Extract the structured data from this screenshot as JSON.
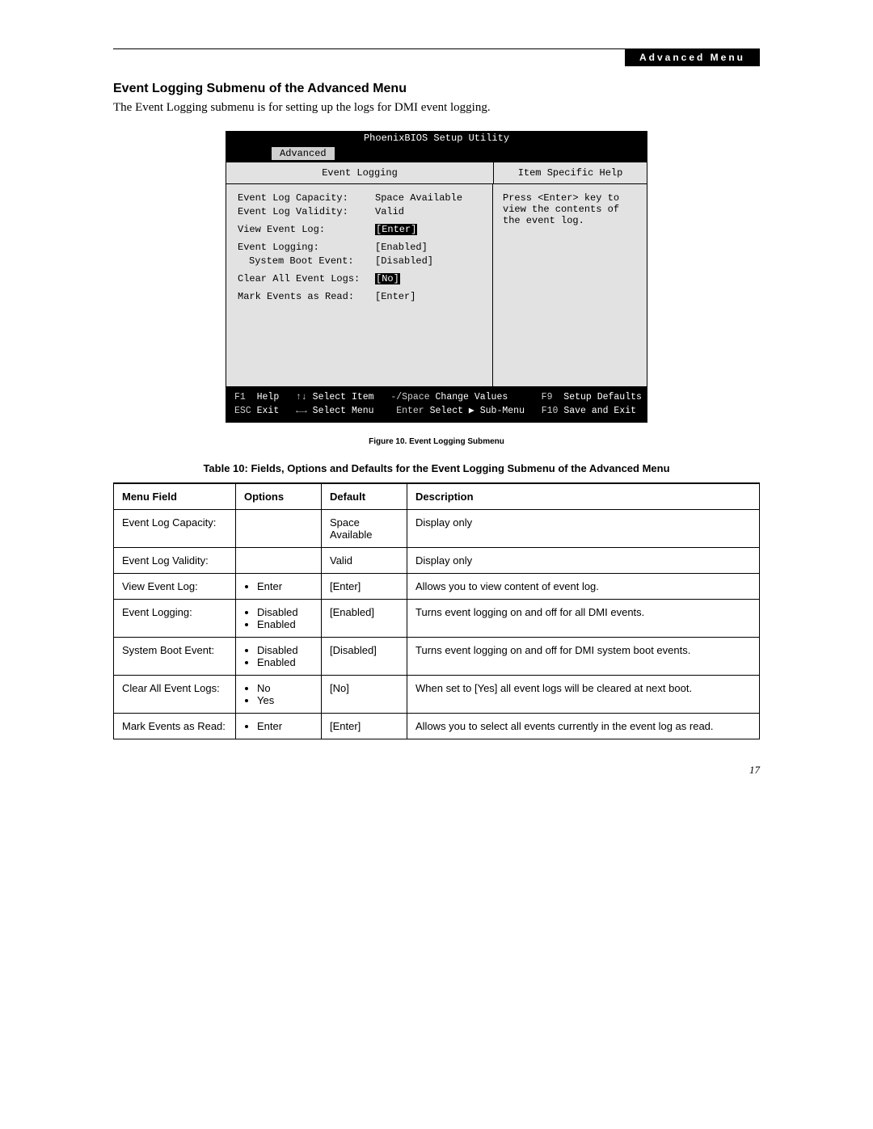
{
  "header": {
    "tab": "Advanced Menu"
  },
  "section": {
    "title": "Event Logging Submenu of the Advanced Menu",
    "intro": "The Event Logging submenu is for setting up the logs for DMI event logging."
  },
  "bios": {
    "title": "PhoenixBIOS Setup Utility",
    "menu_tab": "Advanced",
    "panel_title": "Event Logging",
    "help_title": "Item Specific Help",
    "help_text": "Press <Enter> key to view the contents of the event log.",
    "rows": [
      {
        "label": "Event Log Capacity:",
        "value": "Space Available",
        "sel": false,
        "indent": false,
        "gap": false
      },
      {
        "label": "Event Log Validity:",
        "value": "Valid",
        "sel": false,
        "indent": false,
        "gap": false
      },
      {
        "label": "View Event Log:",
        "value": "[Enter]",
        "sel": true,
        "indent": false,
        "gap": true
      },
      {
        "label": "Event Logging:",
        "value": "[Enabled]",
        "sel": false,
        "indent": false,
        "gap": true
      },
      {
        "label": "System Boot Event:",
        "value": "[Disabled]",
        "sel": false,
        "indent": true,
        "gap": false
      },
      {
        "label": "Clear All Event Logs:",
        "value": "[No]",
        "sel": true,
        "indent": false,
        "gap": true
      },
      {
        "label": "Mark Events as Read:",
        "value": "[Enter]",
        "sel": false,
        "indent": false,
        "gap": true
      }
    ],
    "footer": {
      "f1": "F1",
      "help": "Help",
      "arrows_v": "↑↓",
      "select_item": "Select Item",
      "msp": "-/Space",
      "change": "Change Values",
      "f9": "F9",
      "defaults": "Setup Defaults",
      "esc": "ESC",
      "exit": "Exit",
      "arrows_h": "←→",
      "select_menu": "Select Menu",
      "enter": "Enter",
      "submenu": "Select ▶ Sub-Menu",
      "f10": "F10",
      "save": "Save and Exit"
    }
  },
  "fig_caption": "Figure 10.  Event Logging Submenu",
  "table_caption": "Table 10: Fields, Options and Defaults for the Event Logging Submenu of the Advanced Menu",
  "table": {
    "headers": {
      "c1": "Menu Field",
      "c2": "Options",
      "c3": "Default",
      "c4": "Description"
    },
    "rows": [
      {
        "field": "Event Log Capacity:",
        "options": [],
        "default": "Space Available",
        "desc": "Display only"
      },
      {
        "field": "Event Log Validity:",
        "options": [],
        "default": "Valid",
        "desc": "Display only"
      },
      {
        "field": "View Event Log:",
        "options": [
          "Enter"
        ],
        "default": "[Enter]",
        "desc": "Allows you to view content of event log."
      },
      {
        "field": "Event Logging:",
        "options": [
          "Disabled",
          "Enabled"
        ],
        "default": "[Enabled]",
        "desc": "Turns event logging on and off for all DMI events."
      },
      {
        "field": "System Boot Event:",
        "options": [
          "Disabled",
          "Enabled"
        ],
        "default": "[Disabled]",
        "desc": "Turns event logging on and off for DMI system boot events."
      },
      {
        "field": "Clear All Event Logs:",
        "options": [
          "No",
          "Yes"
        ],
        "default": "[No]",
        "desc": "When set to [Yes] all event logs will be cleared at next boot."
      },
      {
        "field": "Mark Events as Read:",
        "options": [
          "Enter"
        ],
        "default": "[Enter]",
        "desc": "Allows you to select all events currently in the event log as read."
      }
    ]
  },
  "page_number": "17"
}
